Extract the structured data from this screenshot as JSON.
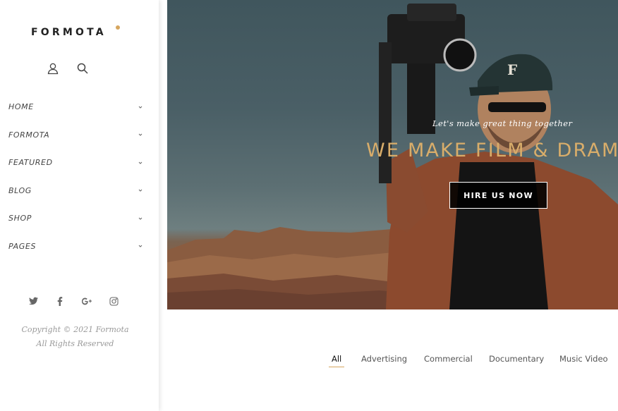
{
  "sidebar": {
    "logo": "FORMOTA",
    "accent_color": "#d6a65f",
    "top_icons": [
      "user-icon",
      "search-icon"
    ],
    "menu": [
      {
        "label": "HOME"
      },
      {
        "label": "FORMOTA"
      },
      {
        "label": "FEATURED"
      },
      {
        "label": "BLOG"
      },
      {
        "label": "SHOP"
      },
      {
        "label": "PAGES"
      }
    ],
    "social": [
      "twitter-icon",
      "facebook-icon",
      "google-plus-icon",
      "instagram-icon"
    ],
    "copyright_line1": "Copyright © 2021 Formota",
    "copyright_line2": "All Rights Reserved"
  },
  "hero": {
    "tagline": "Let's make great thing together",
    "title": "WE MAKE FILM & DRAM",
    "button_label": "HIRE US NOW",
    "title_color": "#d9ad6a"
  },
  "filters": {
    "items": [
      "All",
      "Advertising",
      "Commercial",
      "Documentary",
      "Music Video"
    ],
    "active": "All"
  }
}
